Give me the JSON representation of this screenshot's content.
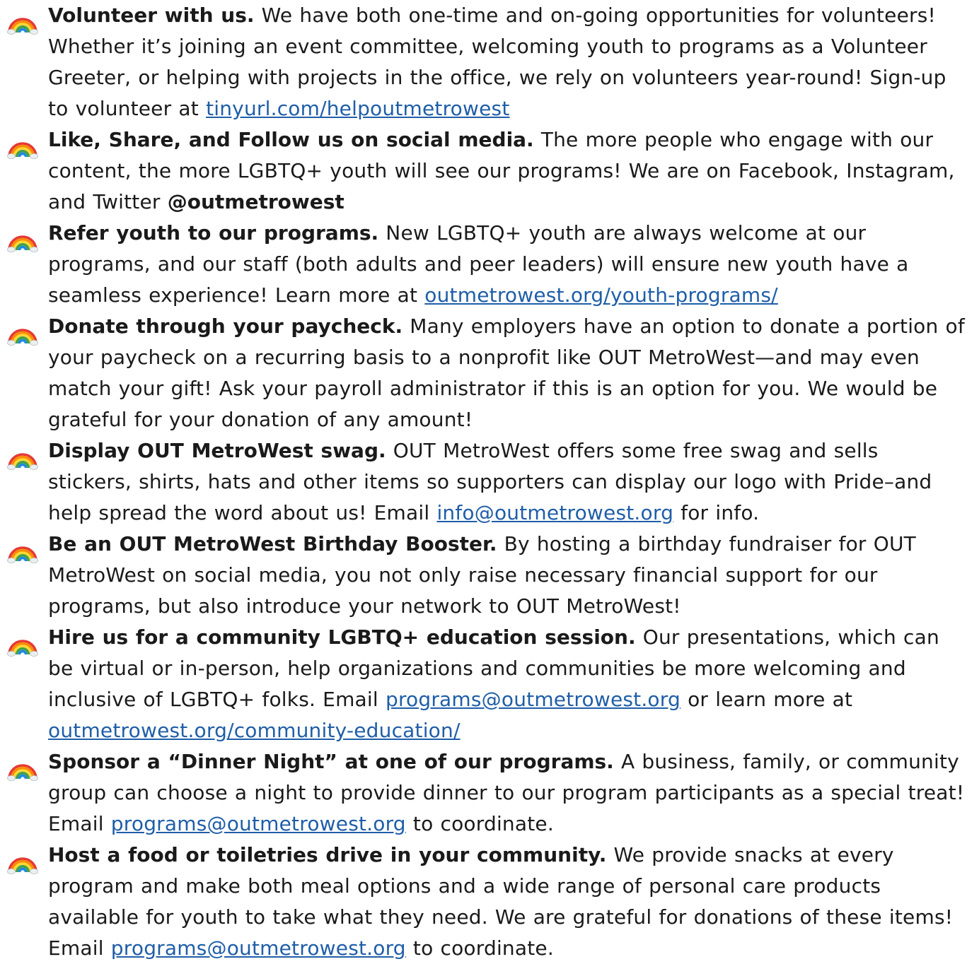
{
  "items": [
    {
      "heading": "Volunteer with us.",
      "body": "We have both one-time and on-going opportunities for volunteers! Whether it’s joining an event committee, welcoming youth to programs as a Volunteer Greeter, or helping with projects in the office, we rely on volunteers year-round! Sign-up to volunteer at ",
      "link": "tinyurl.com/helpoutmetrowest",
      "tail": ""
    },
    {
      "heading": "Like, Share, and Follow us on social media.",
      "body": "The more people who engage with our content, the more LGBTQ+ youth will see our programs! We are on Facebook, Instagram, and Twitter ",
      "handle": "@outmetrowest"
    },
    {
      "heading": "Refer youth to our programs.",
      "body": "New LGBTQ+ youth are always welcome at our programs, and our staff (both adults and peer leaders) will ensure new youth have a seamless experience! Learn more at ",
      "link": "outmetrowest.org/youth-programs/",
      "tail": ""
    },
    {
      "heading": "Donate through your paycheck.",
      "body": "Many employers have an option to donate a portion of your paycheck on a recurring basis to a nonprofit like OUT MetroWest—and may even match your gift! Ask your payroll administrator if this is an option for you. We would be grateful for your donation of any amount!"
    },
    {
      "heading": "Display OUT MetroWest swag.",
      "body": "OUT MetroWest offers some free swag and sells stickers, shirts, hats and other items so supporters can display our logo with Pride–and help spread the word about us! Email ",
      "link": "info@outmetrowest.org",
      "tail": " for info."
    },
    {
      "heading": "Be an OUT MetroWest Birthday Booster.",
      "body": "By hosting a birthday fundraiser for OUT MetroWest on social media, you not only raise necessary financial support for our programs, but also introduce your network to OUT MetroWest!"
    },
    {
      "heading": "Hire us for a community LGBTQ+ education session.",
      "body": "Our presentations, which can be virtual or in-person, help organizations and communities be more welcoming and inclusive of LGBTQ+ folks. Email ",
      "link": "programs@outmetrowest.org",
      "middle": " or learn more at ",
      "link2": "outmetrowest.org/community-education/"
    },
    {
      "heading": "Sponsor a “Dinner Night” at one of our programs.",
      "body": "A business, family, or community group can choose a night to provide dinner to our program participants as a special treat! Email ",
      "link": "programs@outmetrowest.org",
      "tail": " to coordinate."
    },
    {
      "heading": "Host a food or toiletries drive in your community.",
      "body": "We provide snacks at every program and make both meal options and a wide range of personal care products available for youth to take what they need. We are grateful for donations of these items! Email ",
      "link": "programs@outmetrowest.org",
      "tail": " to coordinate."
    }
  ],
  "colors": {
    "text": "#1a1a1a",
    "link": "#1f5ea8"
  },
  "icon": "rainbow-emoji-icon"
}
